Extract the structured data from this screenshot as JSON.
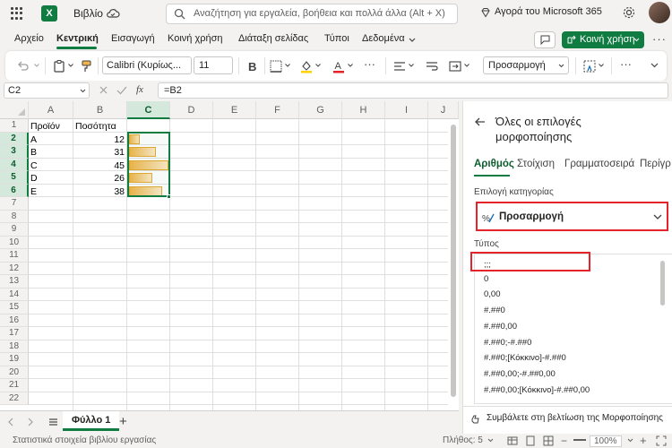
{
  "titlebar": {
    "app_name": "X",
    "book_title": "Βιβλίο",
    "search_placeholder": "Αναζήτηση για εργαλεία, βοήθεια και πολλά άλλα (Alt + X)",
    "buy_label": "Αγορά του Microsoft 365"
  },
  "tabs": {
    "items": [
      "Αρχείο",
      "Κεντρική",
      "Εισαγωγή",
      "Κοινή χρήση",
      "Διάταξη σελίδας",
      "Τύποι",
      "Δεδομένα"
    ],
    "active": "Κεντρική",
    "share_label": "Κοινή χρήση",
    "more": "···"
  },
  "ribbon": {
    "font_name": "Calibri (Κυρίως...",
    "font_size": "11",
    "number_format": "Προσαρμογή",
    "more": "···"
  },
  "formula_bar": {
    "cell_ref": "C2",
    "fx": "fx",
    "formula": "=B2"
  },
  "sheet": {
    "columns": [
      "A",
      "B",
      "C",
      "D",
      "E",
      "F",
      "G",
      "H",
      "I",
      "J"
    ],
    "selected_column": "C",
    "rows": [
      "1",
      "2",
      "3",
      "4",
      "5",
      "6",
      "7",
      "8",
      "9",
      "10",
      "11",
      "12",
      "13",
      "14",
      "15",
      "16",
      "17",
      "18",
      "19",
      "20",
      "21",
      "22"
    ],
    "selected_rows": [
      "2",
      "3",
      "4",
      "5",
      "6"
    ],
    "header_a": "Προϊόν",
    "header_b": "Ποσότητα",
    "data": [
      {
        "product": "A",
        "qty": "12",
        "bar_fraction": 0.27
      },
      {
        "product": "B",
        "qty": "31",
        "bar_fraction": 0.69
      },
      {
        "product": "C",
        "qty": "45",
        "bar_fraction": 1.0
      },
      {
        "product": "D",
        "qty": "26",
        "bar_fraction": 0.58
      },
      {
        "product": "E",
        "qty": "38",
        "bar_fraction": 0.84
      }
    ]
  },
  "sheet_tabs": {
    "active": "Φύλλο 1",
    "add": "+"
  },
  "statusbar": {
    "left_text": "Στατιστικά στοιχεία βιβλίου εργασίας",
    "count": "Πλήθος: 5",
    "zoom": "100%"
  },
  "panel": {
    "title": "Όλες οι επιλογές μορφοποίησης",
    "tabs": [
      "Αριθμός",
      "Στοίχιση",
      "Γραμματοσειρά",
      "Περίγρ"
    ],
    "category_label": "Επιλογή κατηγορίας",
    "category_value": "Προσαρμογή",
    "type_label": "Τύπος",
    "types": [
      ";;;",
      "0",
      "0,00",
      "#.##0",
      "#.##0,00",
      "#.##0;-#.##0",
      "#.##0;[Κόκκινο]-#.##0",
      "#.##0,00;-#.##0,00",
      "#.##0,00;[Κόκκινο]-#.##0,00"
    ],
    "feedback": "Συμβάλετε στη βελτίωση της Μορφοποίησης"
  },
  "colors": {
    "accent": "#107c41",
    "highlight": "#e3242b",
    "bar": "#f0b64b"
  }
}
